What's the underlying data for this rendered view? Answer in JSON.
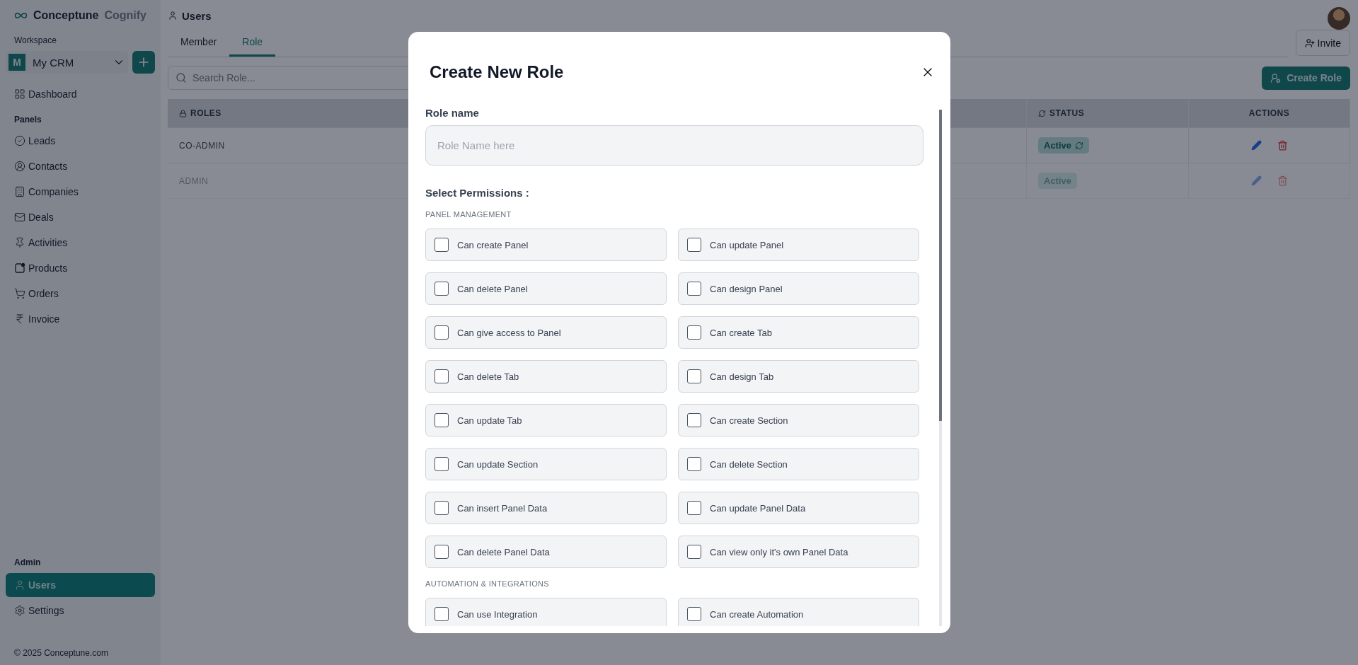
{
  "brand": {
    "name": "Conceptune",
    "suffix": "Cognify"
  },
  "workspace": {
    "label": "Workspace",
    "badge": "M",
    "name": "My CRM"
  },
  "sidebar": {
    "top_items": [
      {
        "label": "Dashboard",
        "selected": false
      }
    ],
    "panels_label": "Panels",
    "panel_items": [
      {
        "label": "Leads",
        "selected": false
      },
      {
        "label": "Contacts",
        "selected": false
      },
      {
        "label": "Companies",
        "selected": false
      },
      {
        "label": "Deals",
        "selected": false
      },
      {
        "label": "Activities",
        "selected": false
      },
      {
        "label": "Products",
        "selected": false
      },
      {
        "label": "Orders",
        "selected": false
      },
      {
        "label": "Invoice",
        "selected": false
      }
    ],
    "admin_label": "Admin",
    "admin_items": [
      {
        "label": "Users",
        "selected": true
      },
      {
        "label": "Settings",
        "selected": false
      }
    ],
    "footer": "© 2025 Conceptune.com"
  },
  "page_title": "Users",
  "tabs": [
    {
      "label": "Member",
      "selected": false
    },
    {
      "label": "Role",
      "selected": true
    }
  ],
  "invite_button": "Invite",
  "search": {
    "placeholder": "Search Role..."
  },
  "create_button": "Create Role",
  "table": {
    "columns": [
      "ROLES",
      "STATUS",
      "ACTIONS"
    ],
    "rows": [
      {
        "role": "CO-ADMIN",
        "status": "Active",
        "disabled": false
      },
      {
        "role": "ADMIN",
        "status": "Active",
        "disabled": true
      }
    ]
  },
  "modal": {
    "title": "Create New Role",
    "role_name_label": "Role name",
    "role_name": {
      "placeholder": "Role Name here"
    },
    "permissions_label": "Select Permissions :",
    "groups": [
      {
        "title": "PANEL MANAGEMENT",
        "permissions": [
          {
            "label": "Can create Panel",
            "checked": false
          },
          {
            "label": "Can update Panel",
            "checked": false
          },
          {
            "label": "Can delete Panel",
            "checked": false
          },
          {
            "label": "Can design Panel",
            "checked": false
          },
          {
            "label": "Can give access to Panel",
            "checked": false
          },
          {
            "label": "Can create Tab",
            "checked": false
          },
          {
            "label": "Can delete Tab",
            "checked": false
          },
          {
            "label": "Can design Tab",
            "checked": false
          },
          {
            "label": "Can update Tab",
            "checked": false
          },
          {
            "label": "Can create Section",
            "checked": false
          },
          {
            "label": "Can update Section",
            "checked": false
          },
          {
            "label": "Can delete Section",
            "checked": false
          },
          {
            "label": "Can insert Panel Data",
            "checked": false
          },
          {
            "label": "Can update Panel Data",
            "checked": false
          },
          {
            "label": "Can delete Panel Data",
            "checked": false
          },
          {
            "label": "Can view only it's own Panel Data",
            "checked": false
          }
        ]
      },
      {
        "title": "AUTOMATION & INTEGRATIONS",
        "permissions": [
          {
            "label": "Can use Integration",
            "checked": false
          },
          {
            "label": "Can create Automation",
            "checked": false
          }
        ]
      }
    ]
  }
}
